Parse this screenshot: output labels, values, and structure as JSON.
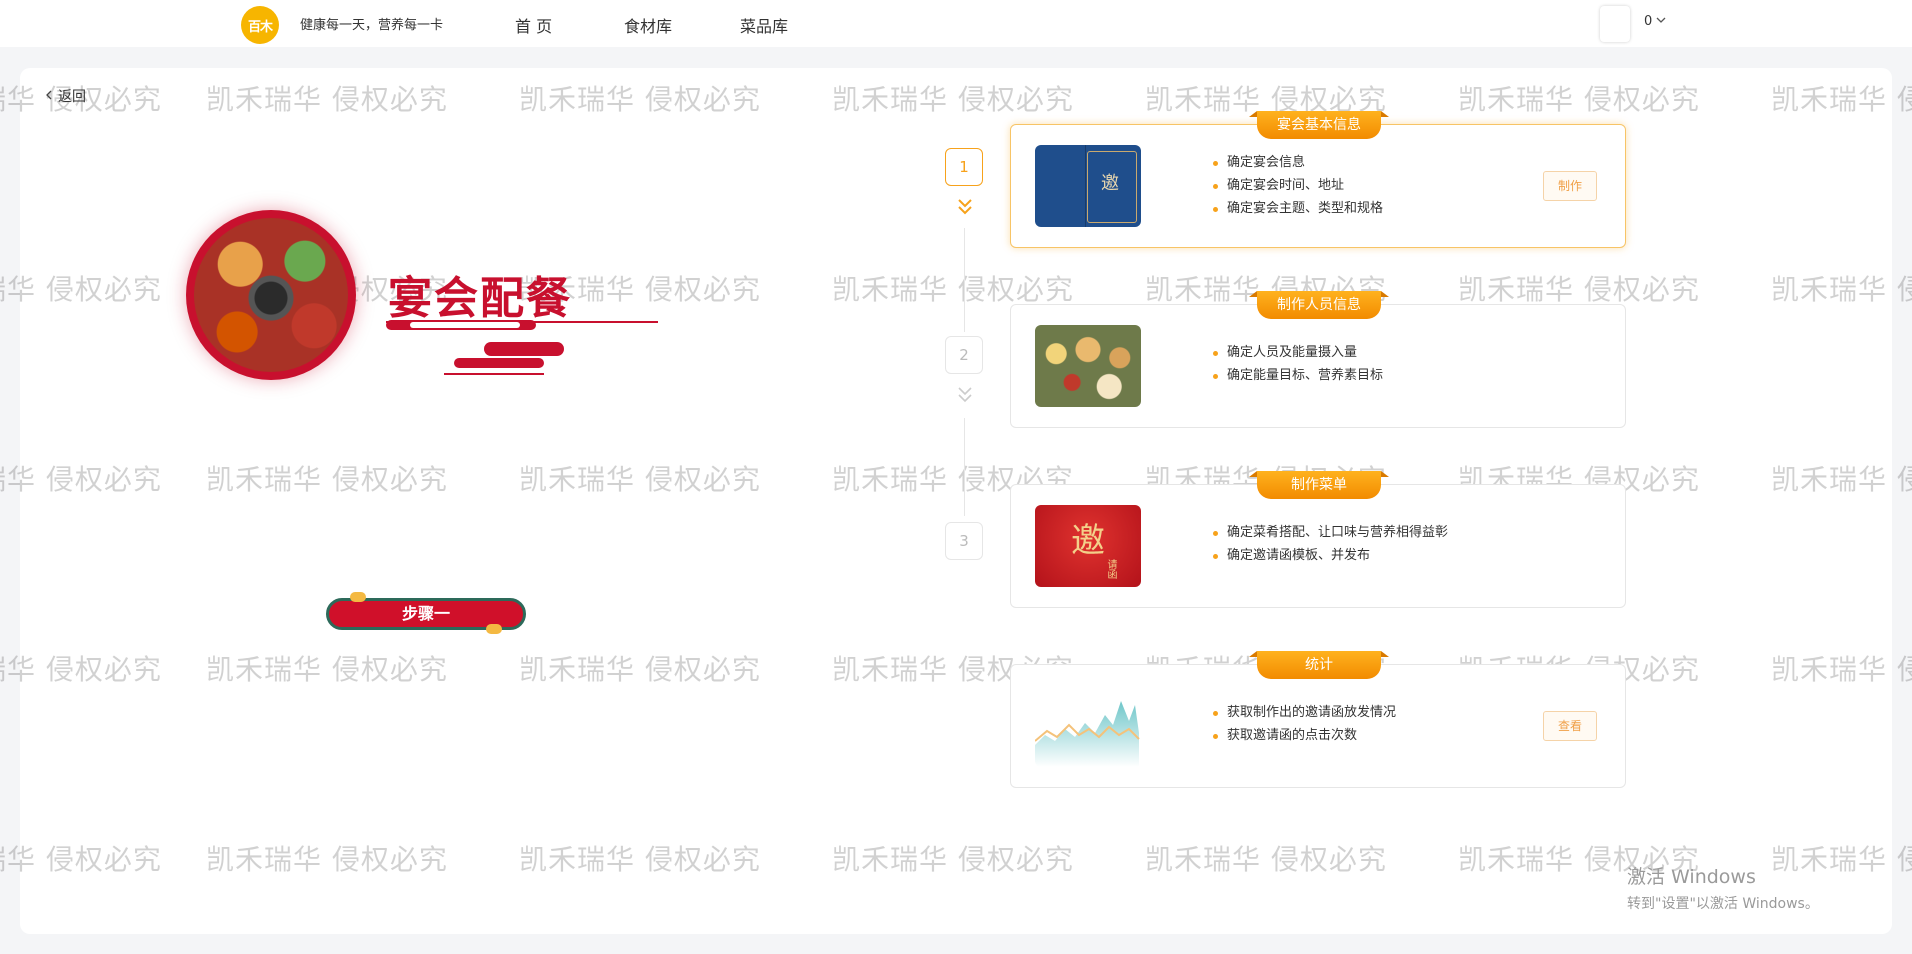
{
  "header": {
    "logo_text": "百木",
    "slogan": "健康每一天，营养每一卡",
    "nav": [
      "首 页",
      "食材库",
      "菜品库"
    ],
    "user_count": "0"
  },
  "back_label": "返回",
  "hero": {
    "title": "宴会配餐",
    "step_label": "步骤一"
  },
  "steps": [
    {
      "num": "1",
      "active": true
    },
    {
      "num": "2",
      "active": false
    },
    {
      "num": "3",
      "active": false
    }
  ],
  "cards": [
    {
      "tag": "宴会基本信息",
      "bullets": [
        "确定宴会信息",
        "确定宴会时间、地址",
        "确定宴会主题、类型和规格"
      ],
      "button": "制作",
      "thumb_text": "邀"
    },
    {
      "tag": "制作人员信息",
      "bullets": [
        "确定人员及能量摄入量",
        "确定能量目标、营养素目标"
      ],
      "button": ""
    },
    {
      "tag": "制作菜单",
      "bullets": [
        "确定菜肴搭配、让口味与营养相得益彰",
        "确定邀请函模板、并发布"
      ],
      "button": "",
      "thumb_text": "邀",
      "thumb_sub": "请函"
    },
    {
      "tag": "统计",
      "bullets": [
        "获取制作出的邀请函放发情况",
        "获取邀请函的点击次数"
      ],
      "button": "查看"
    }
  ],
  "watermark": "凯禾瑞华 侵权必究",
  "activate_windows": {
    "line1": "激活 Windows",
    "line2": "转到\"设置\"以激活 Windows。"
  },
  "colors": {
    "accent": "#f7a21b",
    "hero_red": "#c8102e",
    "logo_yellow": "#f7b500"
  }
}
